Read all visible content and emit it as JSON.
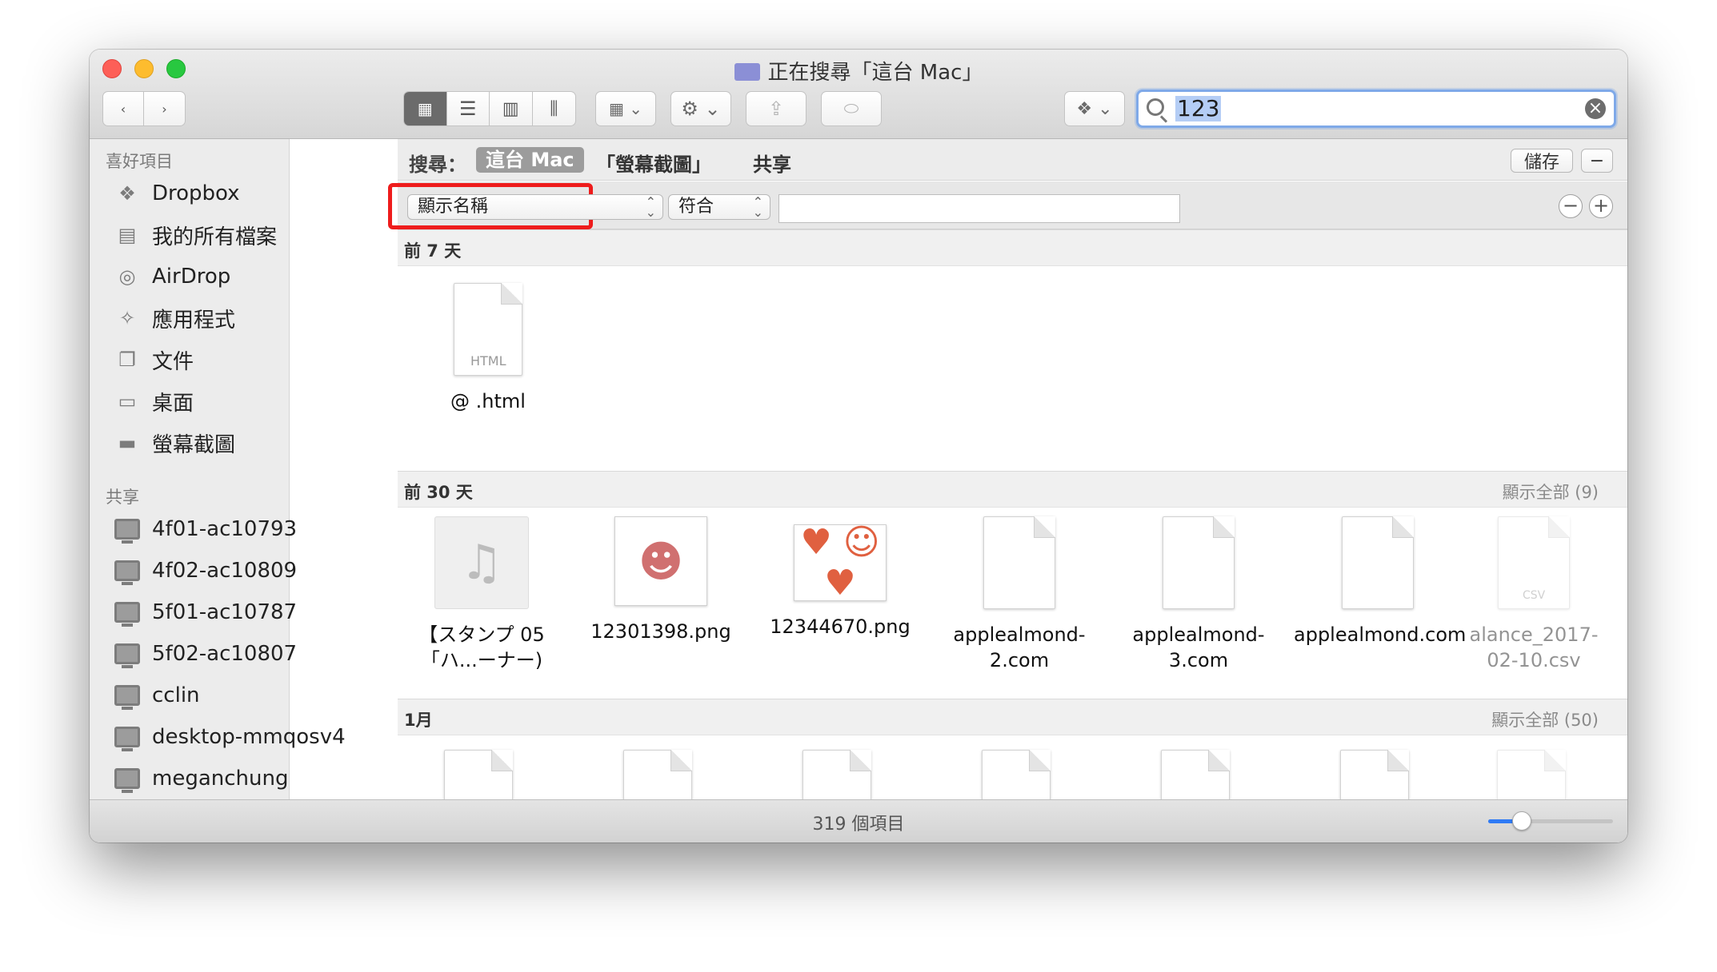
{
  "window": {
    "title": "正在搜尋「這台 Mac」"
  },
  "search": {
    "value": "123"
  },
  "sidebar": {
    "favorites_header": "喜好項目",
    "favorites": [
      "Dropbox",
      "我的所有檔案",
      "AirDrop",
      "應用程式",
      "文件",
      "桌面",
      "螢幕截圖"
    ],
    "shared_header": "共享",
    "shared": [
      "4f01-ac10793",
      "4f02-ac10809",
      "5f01-ac10787",
      "5f02-ac10807",
      "cclin",
      "desktop-mmqosv4",
      "meganchung"
    ]
  },
  "scope": {
    "label": "搜尋：",
    "active": "這台 Mac",
    "options": [
      "「螢幕截圖」",
      "共享"
    ],
    "save": "儲存"
  },
  "criteria": {
    "attribute": "顯示名稱",
    "operator": "符合"
  },
  "sections": [
    {
      "label": "前 7 天",
      "files": [
        {
          "name": "@ .html",
          "badge": "HTML"
        }
      ]
    },
    {
      "label": "前 30 天",
      "show_all": "顯示全部 (9)",
      "files": [
        {
          "name": "【スタンプ 05「ハ...ーナー)"
        },
        {
          "name": "12301398.png"
        },
        {
          "name": "12344670.png"
        },
        {
          "name": "applealmond-2.com"
        },
        {
          "name": "applealmond-3.com"
        },
        {
          "name": "applealmond.com"
        },
        {
          "name": "alance_2017-02-10.csv",
          "badge": "CSV"
        }
      ]
    },
    {
      "label": "1月",
      "show_all": "顯示全部 (50)"
    }
  ],
  "status": {
    "text": "319 個項目",
    "zoom": 0.27
  },
  "colors": {
    "highlight": "#ee1c1c",
    "accent": "#2f7bf5"
  }
}
